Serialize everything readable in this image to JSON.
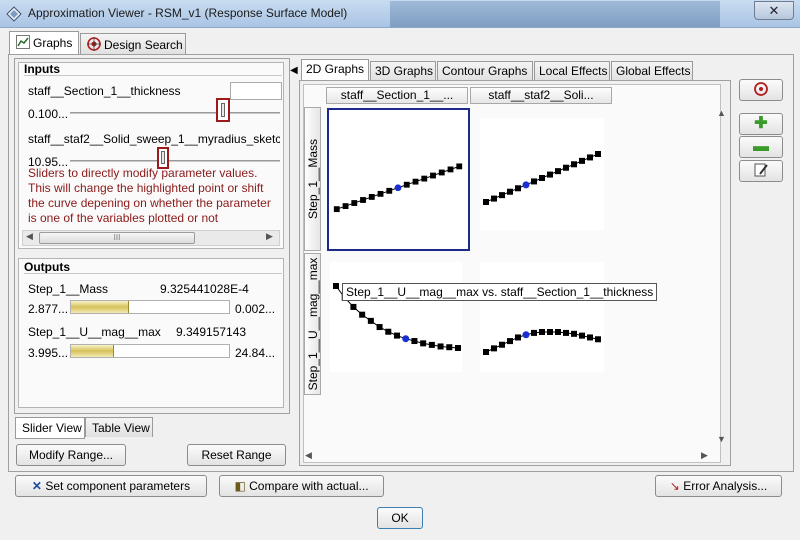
{
  "window": {
    "title": "Approximation Viewer - RSM_v1 (Response Surface Model)",
    "close_glyph": "✕",
    "icon": "app-icon"
  },
  "outer_tabs": [
    {
      "label": "Graphs",
      "icon": "chart-icon",
      "active": true
    },
    {
      "label": "Design Search",
      "icon": "target-icon",
      "active": false
    }
  ],
  "inputs": {
    "title": "Inputs",
    "params": [
      {
        "name": "staff__Section_1__thickness",
        "value": "0.100..."
      },
      {
        "name": "staff__staf2__Solid_sweep_1__myradius_sketc",
        "value": "10.95..."
      }
    ],
    "hint": "Sliders to directly modify parameter values. This will change the highlighted point or shift the curve depening on whether the parameter is one of the variables plotted or not",
    "scroll_grip": "III"
  },
  "outputs": {
    "title": "Outputs",
    "items": [
      {
        "name": "Step_1__Mass",
        "current": "9.325441028E-4",
        "min": "2.877...",
        "max": "0.002...",
        "fill": 0.37
      },
      {
        "name": "Step_1__U__mag__max",
        "current": "9.349157143",
        "min": "3.995...",
        "max": "24.84...",
        "fill": 0.27
      }
    ]
  },
  "view_tabs": [
    {
      "label": "Slider View",
      "active": true
    },
    {
      "label": "Table View",
      "active": false
    }
  ],
  "buttons": {
    "modify_range": "Modify Range...",
    "reset_range": "Reset Range",
    "set_component": "Set component parameters",
    "compare": "Compare with actual...",
    "error_analysis": "Error Analysis...",
    "ok": "OK"
  },
  "graph_tabs": [
    {
      "label": "2D Graphs",
      "active": true
    },
    {
      "label": "3D Graphs",
      "active": false
    },
    {
      "label": "Contour Graphs",
      "active": false
    },
    {
      "label": "Local Effects",
      "active": false
    },
    {
      "label": "Global Effects",
      "active": false
    }
  ],
  "matrix": {
    "columns": [
      "staff__Section_1__...",
      "staff__staf2__Soli..."
    ],
    "rows": [
      "Step_1__Mass",
      "Step_1__U__mag__max"
    ],
    "tooltip": "Step_1__U__mag__max vs. staff__Section_1__thickness"
  },
  "colors": {
    "point": "#000000",
    "highlight": "#1a2fd0",
    "selected_border": "#1c2a8c",
    "hint_text": "#8b1a1a"
  },
  "chart_data": [
    {
      "type": "line",
      "row": "Step_1__Mass",
      "column": "staff__Section_1__thickness",
      "x": [
        0,
        1,
        2,
        3,
        4,
        5,
        6,
        7,
        8,
        9,
        10,
        11,
        12,
        13,
        14
      ],
      "values": [
        0.1,
        0.14,
        0.18,
        0.22,
        0.26,
        0.3,
        0.34,
        0.38,
        0.42,
        0.46,
        0.5,
        0.54,
        0.58,
        0.62,
        0.66
      ],
      "highlight_index": 7
    },
    {
      "type": "line",
      "row": "Step_1__Mass",
      "column": "staff__staf2__Solid_sweep_1__myradius",
      "x": [
        0,
        1,
        2,
        3,
        4,
        5,
        6,
        7,
        8,
        9,
        10,
        11,
        12,
        13,
        14
      ],
      "values": [
        0.1,
        0.15,
        0.2,
        0.25,
        0.3,
        0.35,
        0.4,
        0.45,
        0.5,
        0.55,
        0.6,
        0.65,
        0.7,
        0.75,
        0.8
      ],
      "highlight_index": 5
    },
    {
      "type": "line",
      "row": "Step_1__U__mag__max",
      "column": "staff__Section_1__thickness",
      "x": [
        0,
        1,
        2,
        3,
        4,
        5,
        6,
        7,
        8,
        9,
        10,
        11,
        12,
        13,
        14
      ],
      "values": [
        0.95,
        0.8,
        0.68,
        0.58,
        0.5,
        0.42,
        0.36,
        0.31,
        0.27,
        0.24,
        0.21,
        0.19,
        0.17,
        0.16,
        0.15
      ],
      "highlight_index": 8
    },
    {
      "type": "line",
      "row": "Step_1__U__mag__max",
      "column": "staff__staf2__Solid_sweep_1__myradius",
      "x": [
        0,
        1,
        2,
        3,
        4,
        5,
        6,
        7,
        8,
        9,
        10,
        11,
        12,
        13,
        14
      ],
      "values": [
        0.2,
        0.24,
        0.28,
        0.32,
        0.36,
        0.39,
        0.41,
        0.42,
        0.42,
        0.42,
        0.41,
        0.4,
        0.38,
        0.36,
        0.34
      ],
      "highlight_index": 5
    }
  ]
}
